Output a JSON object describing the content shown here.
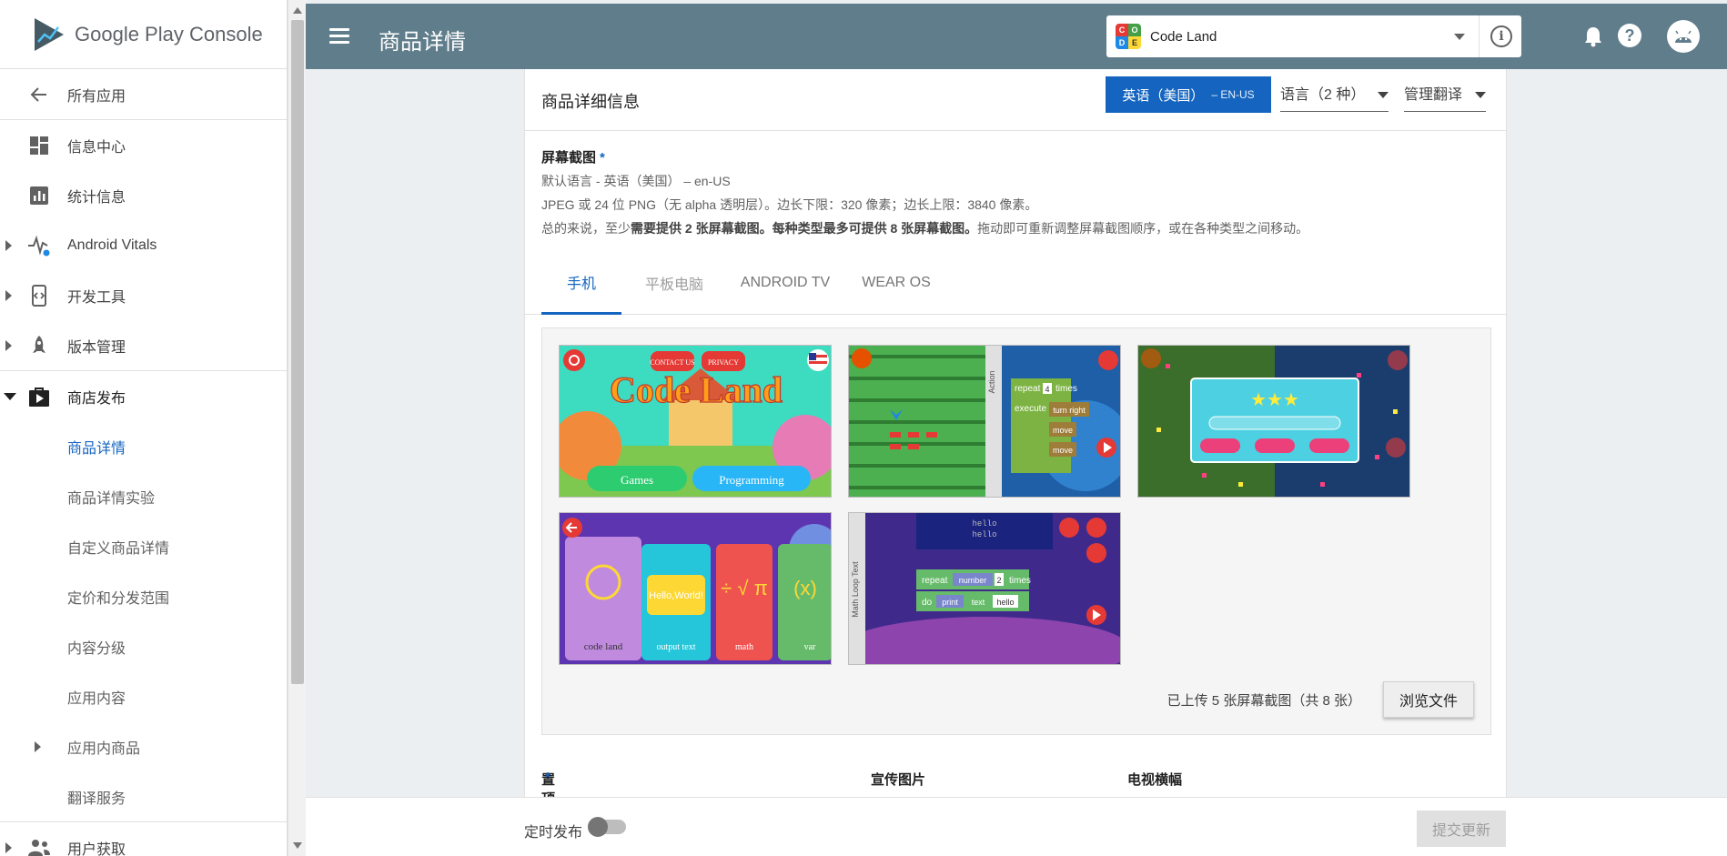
{
  "brand": {
    "name_part1": "Google Play",
    "name_part2": "Console"
  },
  "sidebar": {
    "back_label": "所有应用",
    "items": [
      {
        "label": "信息中心",
        "icon": "dashboard-icon"
      },
      {
        "label": "统计信息",
        "icon": "bar-chart-icon"
      },
      {
        "label": "Android Vitals",
        "icon": "vitals-icon"
      },
      {
        "label": "开发工具",
        "icon": "dev-tools-icon"
      },
      {
        "label": "版本管理",
        "icon": "rocket-icon"
      },
      {
        "label": "商店发布",
        "icon": "store-icon"
      }
    ],
    "sub_items": [
      {
        "label": "商品详情"
      },
      {
        "label": "商品详情实验"
      },
      {
        "label": "自定义商品详情"
      },
      {
        "label": "定价和分发范围"
      },
      {
        "label": "内容分级"
      },
      {
        "label": "应用内容"
      },
      {
        "label": "应用内商品"
      },
      {
        "label": "翻译服务"
      }
    ],
    "user_acq_label": "用户获取"
  },
  "topbar": {
    "title": "商品详情",
    "app_name": "Code Land"
  },
  "card": {
    "title": "商品详细信息",
    "lang_button": "英语（美国）",
    "lang_code": "– EN-US",
    "languages_dd": "语言（2 种）",
    "manage_translations_dd": "管理翻译"
  },
  "screenshots": {
    "title": "屏幕截图",
    "required_mark": "*",
    "line1": "默认语言 - 英语（美国） – en-US",
    "line2": "JPEG 或 24 位 PNG（无 alpha 透明层）。边长下限：320 像素；边长上限：3840 像素。",
    "line3_pre": "总的来说，至少",
    "line3_bold": "需要提供 2 张屏幕截图。每种类型最多可提供 8 张屏幕截图。",
    "line3_post": "拖动即可重新调整屏幕截图顺序，或在各种类型之间移动。",
    "tabs": [
      "手机",
      "平板电脑",
      "ANDROID TV",
      "WEAR OS"
    ],
    "status": "已上传 5 张屏幕截图（共 8 张）",
    "browse_button": "浏览文件",
    "shot_texts": {
      "contact": "CONTACT US",
      "privacy": "PRIVACY",
      "logo": "Code Land",
      "games": "Games",
      "programming": "Programming",
      "action": "Action",
      "repeat": "repeat",
      "times": "times",
      "four": "4",
      "execute": "execute",
      "turn_right": "turn right",
      "move": "move",
      "hello_world": "Hello,World!",
      "code_land": "code land",
      "output_text": "output text",
      "math": "math",
      "var": "var",
      "hello": "hello",
      "number": "number",
      "two": "2",
      "do": "do",
      "print": "print",
      "text": "text",
      "math_loop_text": "Math  Loop  Text"
    }
  },
  "below": {
    "feature_graphic": "置顶大图",
    "promo_graphic": "宣传图片",
    "tv_banner": "电视横幅"
  },
  "footer": {
    "schedule_label": "定时发布",
    "submit_button": "提交更新"
  },
  "colors": {
    "topbar": "#607d8b",
    "accent": "#1565c0"
  }
}
